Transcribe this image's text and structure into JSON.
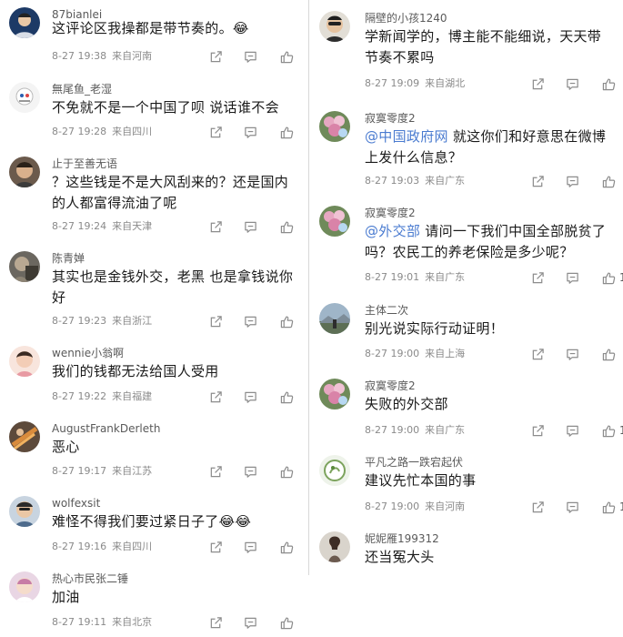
{
  "colors": {
    "text": "#1a1a1a",
    "meta": "#8a8a8a",
    "mention": "#4a7bd0",
    "icon": "#8c8c8c"
  },
  "icons": {
    "share": "share-icon",
    "reply": "comment-icon",
    "like": "thumbs-up-icon"
  },
  "left_comments": [
    {
      "user": "87bianlei",
      "text": "这评论区我操都是带节奏的。😂",
      "date": "8-27 19:38",
      "location": "来自河南",
      "likes": ""
    },
    {
      "user": "無尾鱼_老湿",
      "text": "不免就不是一个中国了呗 说话谁不会",
      "date": "8-27 19:28",
      "location": "来自四川",
      "likes": ""
    },
    {
      "user": "止于至善无语",
      "text": "？这些钱是不是大风刮来的？还是国内的人都富得流油了呢",
      "date": "8-27 19:24",
      "location": "来自天津",
      "likes": ""
    },
    {
      "user": "陈青婵",
      "text": "其实也是金钱外交，老黑 也是拿钱说你好",
      "date": "8-27 19:23",
      "location": "来自浙江",
      "likes": ""
    },
    {
      "user": "wennie小翁啊",
      "text": "我们的钱都无法给国人受用",
      "date": "8-27 19:22",
      "location": "来自福建",
      "likes": ""
    },
    {
      "user": "AugustFrankDerleth",
      "text": "恶心",
      "date": "8-27 19:17",
      "location": "来自江苏",
      "likes": ""
    },
    {
      "user": "wolfexsit",
      "text": "难怪不得我们要过紧日子了😂😂",
      "date": "8-27 19:16",
      "location": "来自四川",
      "likes": ""
    },
    {
      "user": "热心市民张二锤",
      "text": "加油",
      "date": "8-27 19:11",
      "location": "来自北京",
      "likes": ""
    }
  ],
  "right_comments": [
    {
      "user": "隔壁的小孩1240",
      "mention": "",
      "text": "学新闻学的，博主能不能细说，天天带节奏不累吗",
      "date": "8-27 19:09",
      "location": "来自湖北",
      "likes": ""
    },
    {
      "user": "寂寞零度2",
      "mention": "@中国政府网",
      "text": " 就这你们和好意思在微博上发什么信息？",
      "date": "8-27 19:03",
      "location": "来自广东",
      "likes": ""
    },
    {
      "user": "寂寞零度2",
      "mention": "@外交部",
      "text": " 请问一下我们中国全部脱贫了吗？农民工的养老保险是多少呢？",
      "date": "8-27 19:01",
      "location": "来自广东",
      "likes": "1"
    },
    {
      "user": "主体二次",
      "mention": "",
      "text": "别光说实际行动证明！",
      "date": "8-27 19:00",
      "location": "来自上海",
      "likes": ""
    },
    {
      "user": "寂寞零度2",
      "mention": "",
      "text": "失败的外交部",
      "date": "8-27 19:00",
      "location": "来自广东",
      "likes": "1"
    },
    {
      "user": "平凡之路一跌宕起伏",
      "mention": "",
      "text": "建议先忙本国的事",
      "date": "8-27 19:00",
      "location": "来自河南",
      "likes": "1"
    },
    {
      "user": "妮妮雁199312",
      "mention": "",
      "text": "还当冤大头",
      "date": "",
      "location": "",
      "likes": ""
    }
  ]
}
